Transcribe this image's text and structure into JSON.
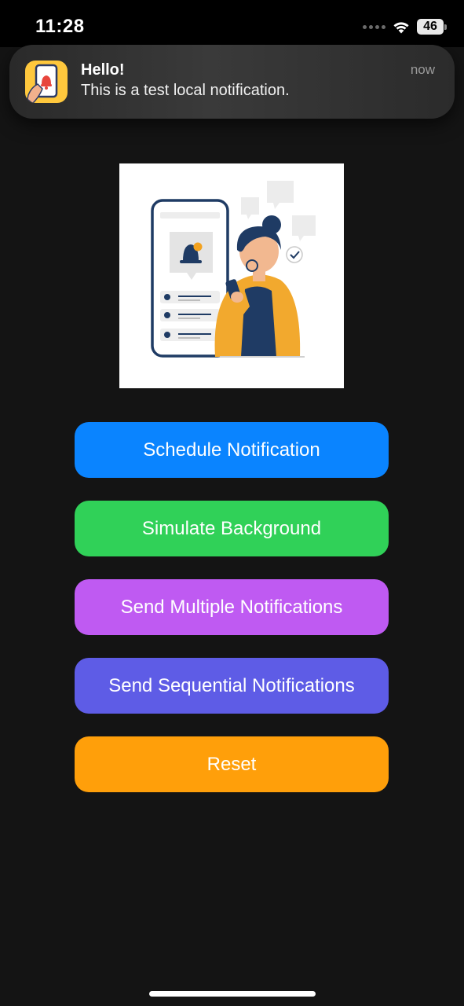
{
  "status_bar": {
    "time": "11:28",
    "battery_level": "46"
  },
  "notification": {
    "title": "Hello!",
    "body": "This is a test local notification.",
    "time": "now",
    "app_icon": "phone-bell-hand-icon"
  },
  "illustration": {
    "description_icon": "notification-illustration"
  },
  "buttons": {
    "schedule": "Schedule Notification",
    "background": "Simulate Background",
    "multiple": "Send Multiple Notifications",
    "sequential": "Send Sequential Notifications",
    "reset": "Reset"
  },
  "colors": {
    "schedule": "#0a84ff",
    "background": "#30d158",
    "multiple": "#bf5af2",
    "sequential": "#5e5ce6",
    "reset": "#ff9f0a",
    "app_background": "#141414"
  }
}
